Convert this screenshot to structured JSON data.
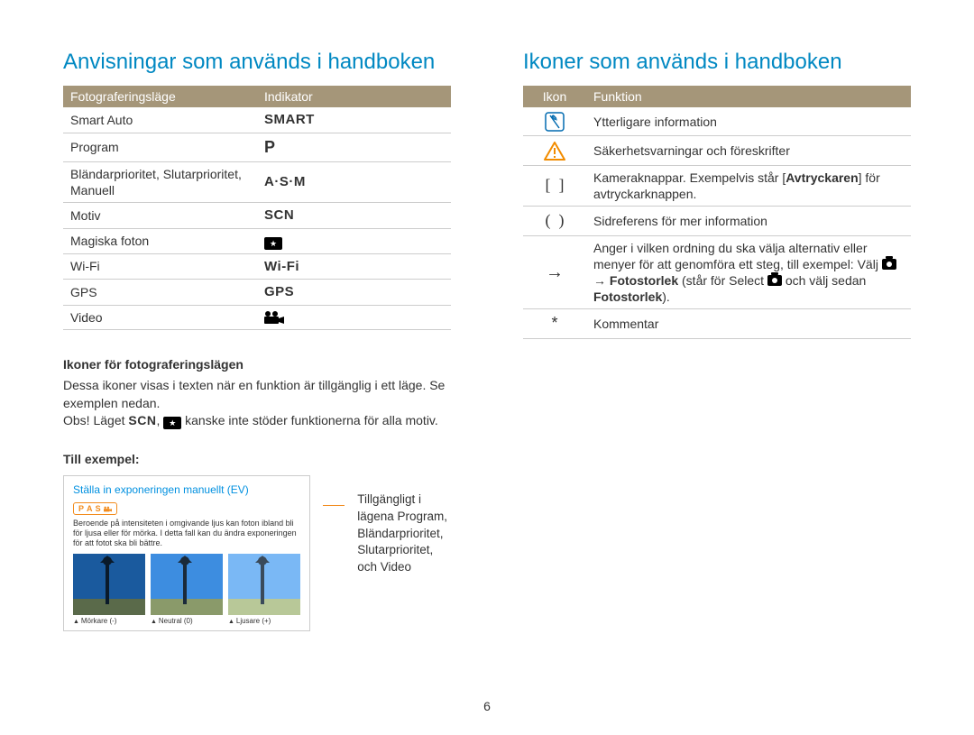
{
  "left": {
    "heading": "Anvisningar som används i handboken",
    "table": {
      "col1": "Fotograferingsläge",
      "col2": "Indikator",
      "rows": [
        {
          "mode": "Smart Auto",
          "ind": "SMART"
        },
        {
          "mode": "Program",
          "ind": "P"
        },
        {
          "mode": "Bländarprioritet, Slutarprioritet, Manuell",
          "ind": "A·S·M"
        },
        {
          "mode": "Motiv",
          "ind": "SCN"
        },
        {
          "mode": "Magiska foton",
          "ind": "★"
        },
        {
          "mode": "Wi-Fi",
          "ind": "Wi-Fi"
        },
        {
          "mode": "GPS",
          "ind": "GPS"
        },
        {
          "mode": "Video",
          "ind": "🎥"
        }
      ]
    },
    "sub1": "Ikoner för fotograferingslägen",
    "p1": "Dessa ikoner visas i texten när en funktion är tillgänglig i ett läge. Se exemplen nedan.",
    "p2a": "Obs! Läget ",
    "p2b": ", ",
    "p2c": " kanske inte stöder funktionerna för alla motiv.",
    "sub2": "Till exempel:",
    "card": {
      "title": "Ställa in exponeringen manuellt (EV)",
      "badge": "P A S 🎥",
      "desc": "Beroende på intensiteten i omgivande ljus kan foton ibland bli för ljusa eller för mörka. I detta fall kan du ändra exponeringen för att fotot ska bli bättre.",
      "captions": [
        "Mörkare (-)",
        "Neutral (0)",
        "Ljusare (+)"
      ]
    },
    "callout": "Tillgängligt i lägena Program, Bländarprioritet, Slutarprioritet, och Video"
  },
  "right": {
    "heading": "Ikoner som används i handboken",
    "table": {
      "col1": "Ikon",
      "col2": "Funktion",
      "rows": [
        {
          "icon": "info",
          "func": "Ytterligare information"
        },
        {
          "icon": "warn",
          "func": "Säkerhetsvarningar och föreskrifter"
        },
        {
          "icon": "brackets",
          "func_html": "Kameraknappar. Exempelvis står [<b>Avtryckaren</b>] för avtryckarknappen."
        },
        {
          "icon": "parens",
          "func": "Sidreferens för mer information"
        },
        {
          "icon": "arrow",
          "func_html": "Anger i vilken ordning du ska välja alternativ eller menyer för att genomföra ett steg, till exempel: Välj <span class='cam-icon'></span> → <b>Fotostorlek</b> (står för Select <span class='cam-icon'></span> och välj sedan <b>Fotostorlek</b>)."
        },
        {
          "icon": "star",
          "func": "Kommentar"
        }
      ]
    }
  },
  "page": "6"
}
